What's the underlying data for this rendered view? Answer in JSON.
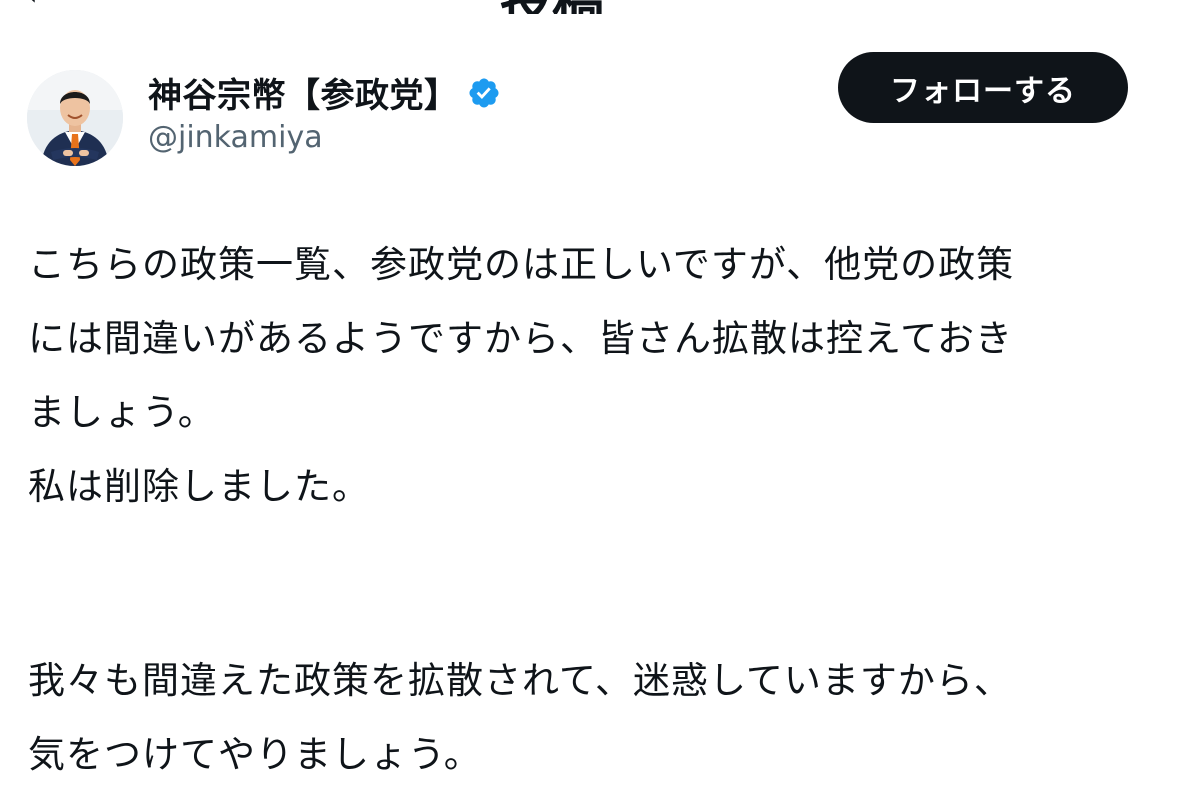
{
  "topbar": {
    "back_glyph": "‹",
    "title": "投稿"
  },
  "author": {
    "display_name": "神谷宗幣【参政党】",
    "handle": "@jinkamiya",
    "verified": true,
    "avatar_icon": "user-avatar-photo"
  },
  "actions": {
    "follow_label": "フォローする"
  },
  "colors": {
    "verified_badge": "#1d9bf0",
    "follow_button_bg": "#0f1419",
    "handle_text": "#536471"
  },
  "post": {
    "lines": [
      "こちらの政策一覧、参政党のは正しいですが、他党の政策",
      "には間違いがあるようですから、皆さん拡散は控えておき",
      "ましょう。",
      "私は削除しました。",
      "我々も間違えた政策を拡散されて、迷惑していますから、",
      "気をつけてやりましょう。"
    ]
  }
}
